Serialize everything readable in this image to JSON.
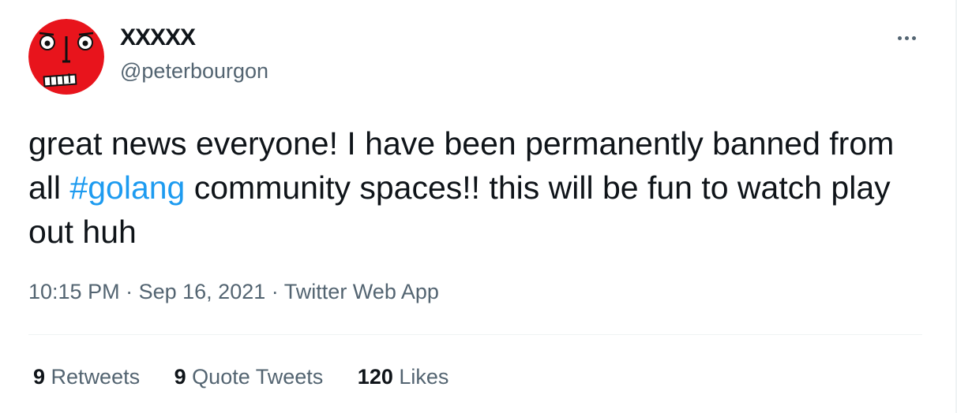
{
  "author": {
    "display_name": "XXXXX",
    "handle": "@peterbourgon",
    "avatar_icon": "red-face-avatar"
  },
  "tweet": {
    "text_part1": "great news everyone! I have been permanently banned from all ",
    "hashtag": "#golang",
    "text_part2": " community spaces!! this will be fun to watch play out huh"
  },
  "meta": {
    "time": "10:15 PM",
    "separator": "·",
    "date": "Sep 16, 2021",
    "source": "Twitter Web App"
  },
  "stats": {
    "retweets_count": "9",
    "retweets_label": "Retweets",
    "quotes_count": "9",
    "quotes_label": "Quote Tweets",
    "likes_count": "120",
    "likes_label": "Likes"
  },
  "colors": {
    "link": "#1d9bf0",
    "secondary_text": "#536471",
    "avatar_red": "#e8141c"
  }
}
